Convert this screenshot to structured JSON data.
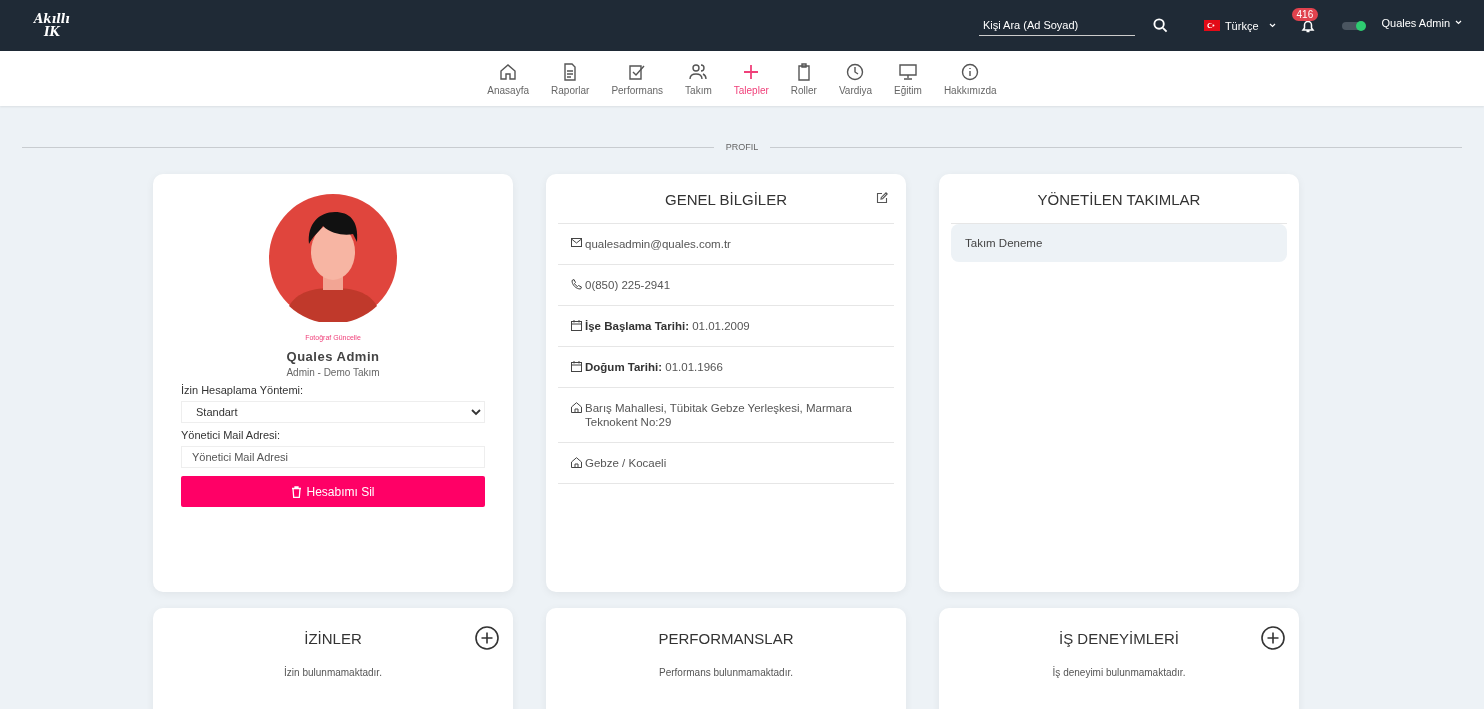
{
  "header": {
    "logo": [
      "Akıllı",
      "IK"
    ],
    "search": {
      "placeholder": "Kişi Ara (Ad Soyad)"
    },
    "language": "Türkçe",
    "notifications": "416",
    "theme_toggle": {
      "on": true
    },
    "user": "Quales Admin"
  },
  "nav": [
    {
      "label": "Anasayfa",
      "selected": false
    },
    {
      "label": "Raporlar",
      "selected": false
    },
    {
      "label": "Performans",
      "selected": false
    },
    {
      "label": "Takım",
      "selected": false
    },
    {
      "label": "Talepler",
      "selected": true
    },
    {
      "label": "Roller",
      "selected": false
    },
    {
      "label": "Vardiya",
      "selected": false
    },
    {
      "label": "Eğitim",
      "selected": false
    },
    {
      "label": "Hakkımızda",
      "selected": false
    }
  ],
  "section_title": "PROFIL",
  "profile": {
    "photo_link": "Fotoğraf Güncelle",
    "name": "Quales Admin",
    "role": "Admin - Demo Takım",
    "leave_method": {
      "label": "İzin Hesaplama Yöntemi:",
      "value": "Standart"
    },
    "manager_mail": {
      "label": "Yönetici Mail Adresi:",
      "placeholder": "Yönetici Mail Adresi"
    },
    "delete_button": "Hesabımı Sil"
  },
  "general_info": {
    "title": "GENEL BİLGİLER",
    "rows": [
      {
        "kind": "email",
        "value": "qualesadmin@quales.com.tr"
      },
      {
        "kind": "phone",
        "value": "0(850) 225-2941"
      },
      {
        "kind": "date",
        "label": "İşe Başlama Tarihi:",
        "value": "01.01.2009"
      },
      {
        "kind": "date",
        "label": "Doğum Tarihi:",
        "value": "01.01.1966"
      },
      {
        "kind": "address",
        "value": "Barış Mahallesi, Tübitak Gebze Yerleşkesi, Marmara Teknokent No:29"
      },
      {
        "kind": "address",
        "value": "Gebze / Kocaeli"
      }
    ]
  },
  "managed_teams": {
    "title": "YÖNETİLEN TAKIMLAR",
    "items": [
      "Takım Deneme"
    ]
  },
  "bottom_cards": [
    {
      "title": "İZİNLER",
      "add_button": true,
      "empty_text": "İzin bulunmamaktadır."
    },
    {
      "title": "PERFORMANSLAR",
      "add_button": false,
      "empty_text": "Performans bulunmamaktadır."
    },
    {
      "title": "İŞ DENEYİMLERİ",
      "add_button": true,
      "empty_text": "İş deneyimi bulunmamaktadır."
    }
  ]
}
